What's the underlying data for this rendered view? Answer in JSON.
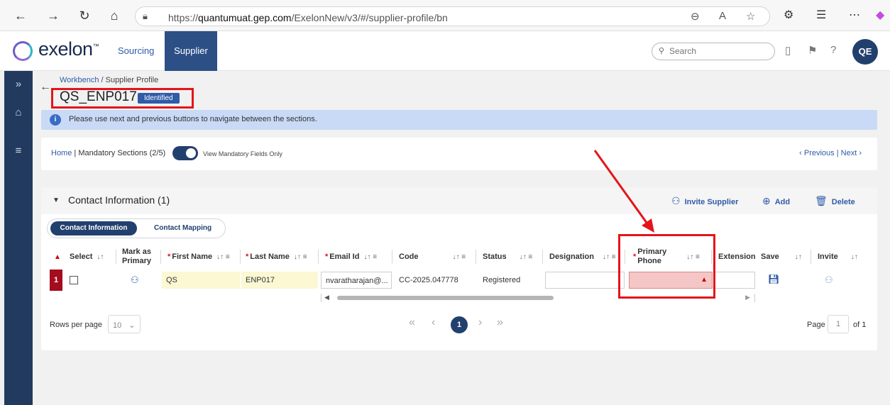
{
  "browser": {
    "url_prefix": "https://",
    "url_host": "quantumuat.gep.com",
    "url_path": "/ExelonNew/v3/#/supplier-profile/bn"
  },
  "header": {
    "logo_text": "exelon",
    "logo_tm": "™",
    "tabs": [
      {
        "label": "Sourcing"
      },
      {
        "label": "Supplier"
      }
    ],
    "search_placeholder": "Search",
    "avatar_initials": "QE"
  },
  "page": {
    "breadcrumb_link": "Workbench",
    "breadcrumb_sep": " / ",
    "breadcrumb_current": "Supplier Profile",
    "title": "QS_ENP017",
    "status": "Identified",
    "info_message": "Please use next and previous buttons to navigate between the sections."
  },
  "nav": {
    "home": "Home",
    "sep": " | ",
    "mandatory": "Mandatory Sections (2/5)",
    "toggle_label": "View Mandatory Fields Only",
    "previous": "‹ Previous",
    "next": "Next ›"
  },
  "section": {
    "title": "Contact Information (1)",
    "actions": {
      "invite": "Invite Supplier",
      "add": "Add",
      "delete": "Delete"
    },
    "subtabs": [
      "Contact Information",
      "Contact Mapping"
    ],
    "columns": {
      "select": "Select",
      "mark_primary_1": "Mark as",
      "mark_primary_2": "Primary",
      "first_name": "First Name",
      "last_name": "Last Name",
      "email": "Email Id",
      "code": "Code",
      "status": "Status",
      "designation": "Designation",
      "primary_phone_1": "Primary",
      "primary_phone_2": "Phone",
      "extension": "Extension",
      "save": "Save",
      "invite": "Invite"
    },
    "row": {
      "index": "1",
      "first_name": "QS",
      "last_name": "ENP017",
      "email": "nvaratharajan@...",
      "code": "CC-2025.047778",
      "status": "Registered"
    },
    "pagination": {
      "rows_per_page_label": "Rows per page",
      "rows_per_page": "10",
      "current": "1",
      "page_label": "Page",
      "page_value": "1",
      "of_label": "of 1"
    }
  },
  "colors": {
    "accent": "#22406e",
    "link": "#2f5ba7",
    "highlight": "#e3151a"
  }
}
